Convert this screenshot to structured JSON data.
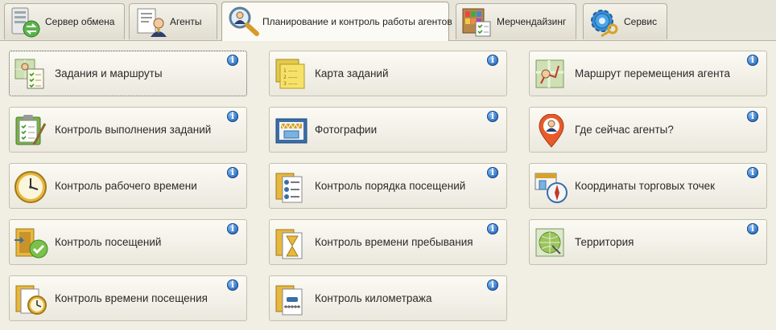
{
  "tabs": [
    {
      "label": "Сервер обмена",
      "icon": "server-exchange-icon"
    },
    {
      "label": "Агенты",
      "icon": "agent-document-icon"
    },
    {
      "label": "Планирование и контроль работы агентов",
      "icon": "magnifier-agent-icon",
      "active": true
    },
    {
      "label": "Мерчендайзинг",
      "icon": "shelf-checklist-icon"
    },
    {
      "label": "Сервис",
      "icon": "gear-key-icon"
    }
  ],
  "cards": [
    {
      "label": "Задания и маршруты",
      "icon": "map-checklist-icon"
    },
    {
      "label": "Карта заданий",
      "icon": "sticky-notes-icon"
    },
    {
      "label": "Маршрут перемещения агента",
      "icon": "route-map-icon"
    },
    {
      "label": "Контроль выполнения заданий",
      "icon": "clipboard-check-icon"
    },
    {
      "label": "Фотографии",
      "icon": "store-photo-icon"
    },
    {
      "label": "Где сейчас агенты?",
      "icon": "location-pin-agent-icon"
    },
    {
      "label": "Контроль рабочего времени",
      "icon": "clock-icon"
    },
    {
      "label": "Контроль порядка посещений",
      "icon": "numbered-list-icon"
    },
    {
      "label": "Координаты торговых точек",
      "icon": "store-compass-icon"
    },
    {
      "label": "Контроль посещений",
      "icon": "door-check-icon"
    },
    {
      "label": "Контроль времени пребывания",
      "icon": "hourglass-icon"
    },
    {
      "label": "Территория",
      "icon": "territory-globe-icon"
    },
    {
      "label": "Контроль времени посещения",
      "icon": "folder-clock-icon"
    },
    {
      "label": "Контроль километража",
      "icon": "mileage-ruler-icon"
    }
  ],
  "info_glyph": "i",
  "colors": {
    "accent": "#2c6fc0",
    "card_border": "#c4bfae",
    "background": "#f1eee4"
  }
}
